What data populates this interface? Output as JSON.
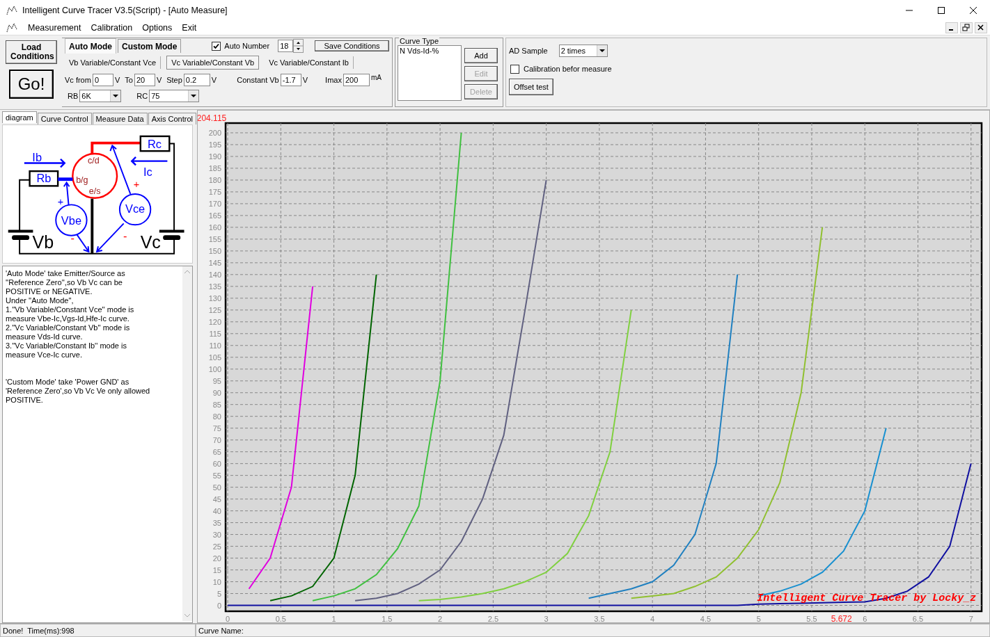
{
  "window": {
    "title": "Intelligent Curve Tracer V3.5(Script) - [Auto Measure]"
  },
  "menu": [
    {
      "label": "Measurement"
    },
    {
      "label": "Calibration"
    },
    {
      "label": "Options"
    },
    {
      "label": "Exit"
    }
  ],
  "toolbar": {
    "load_button": "Load Conditions",
    "go_button": "Go!",
    "mode_tabs": [
      {
        "label": "Auto Mode",
        "selected": true
      },
      {
        "label": "Custom Mode",
        "selected": false
      }
    ],
    "auto_number": {
      "label": "Auto Number",
      "checked": true,
      "value": "18"
    },
    "save_button": "Save Conditions",
    "submodes": [
      {
        "label": "Vb Variable/Constant Vce",
        "selected": false
      },
      {
        "label": "Vc Variable/Constant Vb",
        "selected": true
      },
      {
        "label": "Vc Variable/Constant Ib",
        "selected": false
      }
    ],
    "fields": [
      {
        "label": "Vc from",
        "value": "0",
        "unit": "V"
      },
      {
        "label": "To",
        "value": "20",
        "unit": "V"
      },
      {
        "label": "Step",
        "value": "0.2",
        "unit": "V"
      },
      {
        "label": "Constant Vb",
        "value": "-1.7",
        "unit": "V"
      },
      {
        "label": "Imax",
        "value": "200",
        "unit": "mA"
      }
    ],
    "selects": [
      {
        "label": "RB",
        "value": "6K"
      },
      {
        "label": "RC",
        "value": "75"
      }
    ],
    "curve_type": {
      "title": "Curve Type",
      "items": [
        "N Vds-Id-%"
      ],
      "buttons": [
        {
          "label": "Add",
          "disabled": false
        },
        {
          "label": "Edit",
          "disabled": true
        },
        {
          "label": "Delete",
          "disabled": true
        }
      ]
    },
    "ad_sample": {
      "label": "AD Sample",
      "value": "2 times"
    },
    "calibration": {
      "label": "Calibration befor measure",
      "checked": false
    },
    "offset_button": "Offset test"
  },
  "side_tabs": [
    {
      "label": "diagram",
      "selected": true
    },
    {
      "label": "Curve Control",
      "selected": false
    },
    {
      "label": "Measure Data",
      "selected": false
    },
    {
      "label": "Axis Control",
      "selected": false
    }
  ],
  "diagram": {
    "labels": [
      "Rc",
      "Ib",
      "c/d",
      "Ic",
      "Rb",
      "b/g",
      "+",
      "e/s",
      "+",
      "Vce",
      "Vbe",
      "Vb",
      "-",
      "-",
      "Vc"
    ]
  },
  "notes": [
    {
      "lines": [
        "'Auto Mode' take Emitter/Source as",
        "''Reference Zero'',so Vb Vc can be",
        "POSITIVE or NEGATIVE.",
        "Under ''Auto Mode'',",
        "1.''Vb Variable/Constant Vce'' mode is",
        "measure Vbe-Ic,Vgs-Id,Hfe-Ic curve.",
        "2.''Vc Variable/Constant Vb'' mode is",
        "measure Vds-Id curve.",
        "3.''Vc Variable/Constant Ib'' mode is",
        "measure Vce-Ic curve."
      ]
    },
    {
      "lines": [
        "'Custom Mode' take 'Power GND' as",
        "'Reference Zero',so Vb Vc Ve only allowed",
        "POSITIVE."
      ]
    }
  ],
  "chart": {
    "chart_data": {
      "type": "line",
      "grid": true,
      "xlim": [
        -0.02,
        7.1
      ],
      "ylim": [
        -2.5,
        204.115
      ],
      "x": [
        0,
        0.2,
        0.4,
        0.6,
        0.8,
        1.0,
        1.2,
        1.4,
        1.6,
        1.8,
        2.0,
        2.2,
        2.4,
        2.6,
        2.8,
        3.0,
        3.2,
        3.4,
        3.6,
        3.8,
        4.0,
        4.2,
        4.4,
        4.6,
        4.8,
        5.0,
        5.2,
        5.4,
        5.6,
        5.8,
        6.0,
        6.2,
        6.4,
        6.6,
        6.8,
        7.0
      ],
      "xticks": [
        0,
        0.5,
        1,
        1.5,
        2,
        2.5,
        3,
        3.5,
        4,
        4.5,
        5,
        5.5,
        6,
        6.5,
        7
      ],
      "yticks": [
        0,
        5,
        10,
        15,
        20,
        25,
        30,
        35,
        40,
        45,
        50,
        55,
        60,
        65,
        70,
        75,
        80,
        85,
        90,
        95,
        100,
        105,
        110,
        115,
        120,
        125,
        130,
        135,
        140,
        145,
        150,
        155,
        160,
        165,
        170,
        175,
        180,
        185,
        190,
        195,
        200
      ],
      "series": [
        {
          "color": "#e000e0",
          "values": [
            null,
            7,
            20,
            50,
            135,
            null,
            null,
            null,
            null,
            null,
            null,
            null,
            null,
            null,
            null,
            null,
            null,
            null,
            null,
            null,
            null,
            null,
            null,
            null,
            null,
            null,
            null,
            null,
            null,
            null,
            null,
            null,
            null,
            null,
            null,
            null
          ]
        },
        {
          "color": "#006400",
          "values": [
            null,
            null,
            2,
            4,
            8,
            20,
            55,
            140,
            null,
            null,
            null,
            null,
            null,
            null,
            null,
            null,
            null,
            null,
            null,
            null,
            null,
            null,
            null,
            null,
            null,
            null,
            null,
            null,
            null,
            null,
            null,
            null,
            null,
            null,
            null,
            null
          ]
        },
        {
          "color": "#40c040",
          "values": [
            null,
            null,
            null,
            null,
            2,
            4,
            7,
            13,
            24,
            42,
            95,
            200,
            null,
            null,
            null,
            null,
            null,
            null,
            null,
            null,
            null,
            null,
            null,
            null,
            null,
            null,
            null,
            null,
            null,
            null,
            null,
            null,
            null,
            null,
            null,
            null
          ]
        },
        {
          "color": "#606080",
          "values": [
            null,
            null,
            null,
            null,
            null,
            null,
            2,
            3,
            5,
            9,
            15,
            27,
            45,
            72,
            125,
            180,
            null,
            null,
            null,
            null,
            null,
            null,
            null,
            null,
            null,
            null,
            null,
            null,
            null,
            null,
            null,
            null,
            null,
            null,
            null,
            null
          ]
        },
        {
          "color": "#80d040",
          "values": [
            null,
            null,
            null,
            null,
            null,
            null,
            null,
            null,
            null,
            2,
            2.5,
            3.5,
            5,
            7,
            10,
            14,
            22,
            38,
            65,
            125,
            null,
            null,
            null,
            null,
            null,
            null,
            null,
            null,
            null,
            null,
            null,
            null,
            null,
            null,
            null,
            null
          ]
        },
        {
          "color": "#2080c0",
          "values": [
            null,
            null,
            null,
            null,
            null,
            null,
            null,
            null,
            null,
            null,
            null,
            null,
            null,
            null,
            null,
            null,
            null,
            3,
            5,
            7,
            10,
            17,
            30,
            60,
            140,
            null,
            null,
            null,
            null,
            null,
            null,
            null,
            null,
            null,
            null,
            null
          ]
        },
        {
          "color": "#90c030",
          "values": [
            null,
            null,
            null,
            null,
            null,
            null,
            null,
            null,
            null,
            null,
            null,
            null,
            null,
            null,
            null,
            null,
            null,
            null,
            null,
            3,
            4,
            5,
            8,
            12,
            20,
            32,
            52,
            90,
            160,
            null,
            null,
            null,
            null,
            null,
            null,
            null
          ]
        },
        {
          "color": "#1890d0",
          "values": [
            null,
            null,
            null,
            null,
            null,
            null,
            null,
            null,
            null,
            null,
            null,
            null,
            null,
            null,
            null,
            null,
            null,
            null,
            null,
            null,
            null,
            null,
            null,
            null,
            null,
            4,
            6,
            9,
            14,
            23,
            40,
            75,
            null,
            null,
            null,
            null
          ]
        },
        {
          "color": "#1010a0",
          "values": [
            0,
            0,
            0,
            0,
            0,
            0,
            0,
            0,
            0,
            0,
            0,
            0,
            0,
            0,
            0,
            0,
            0,
            0,
            0,
            0,
            0,
            0,
            0,
            0,
            0,
            0.5,
            0.7,
            0.9,
            1.1,
            1.3,
            1.5,
            3,
            6,
            12,
            25,
            60
          ]
        }
      ],
      "annotations": [
        "204.115",
        "5.672",
        "Intelligent Curve Tracer by Locky_z"
      ]
    }
  },
  "status_bar": {
    "message": "Done!  Time(ms):998",
    "curve_name_label": "Curve Name:"
  }
}
